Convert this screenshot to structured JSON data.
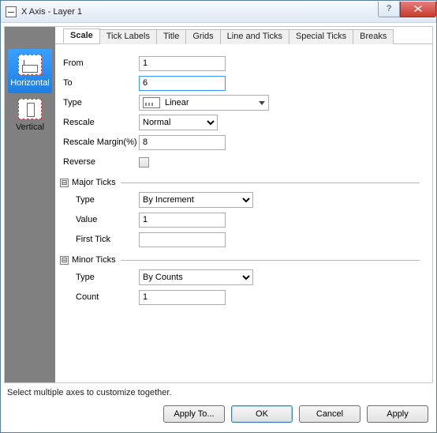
{
  "window": {
    "title": "X Axis - Layer 1"
  },
  "left": {
    "horizontal": "Horizontal",
    "vertical": "Vertical"
  },
  "tabs": {
    "scale": "Scale",
    "tick_labels": "Tick Labels",
    "title": "Title",
    "grids": "Grids",
    "line_ticks": "Line and Ticks",
    "special_ticks": "Special Ticks",
    "breaks": "Breaks"
  },
  "labels": {
    "from": "From",
    "to": "To",
    "type": "Type",
    "rescale": "Rescale",
    "rescale_margin": "Rescale Margin(%)",
    "reverse": "Reverse",
    "major_ticks": "Major Ticks",
    "minor_ticks": "Minor Ticks",
    "value": "Value",
    "first_tick": "First Tick",
    "count": "Count"
  },
  "values": {
    "from": "1",
    "to": "6",
    "type": "Linear",
    "rescale": "Normal",
    "rescale_margin": "8",
    "major_type": "By Increment",
    "major_value": "1",
    "first_tick": "",
    "minor_type": "By Counts",
    "minor_count": "1"
  },
  "options": {
    "rescale": [
      "Normal"
    ],
    "major_type": [
      "By Increment"
    ],
    "minor_type": [
      "By Counts"
    ]
  },
  "hint": "Select multiple axes to customize together.",
  "buttons": {
    "apply_to": "Apply To...",
    "ok": "OK",
    "cancel": "Cancel",
    "apply": "Apply"
  },
  "glyph": {
    "collapse": "⊟"
  }
}
